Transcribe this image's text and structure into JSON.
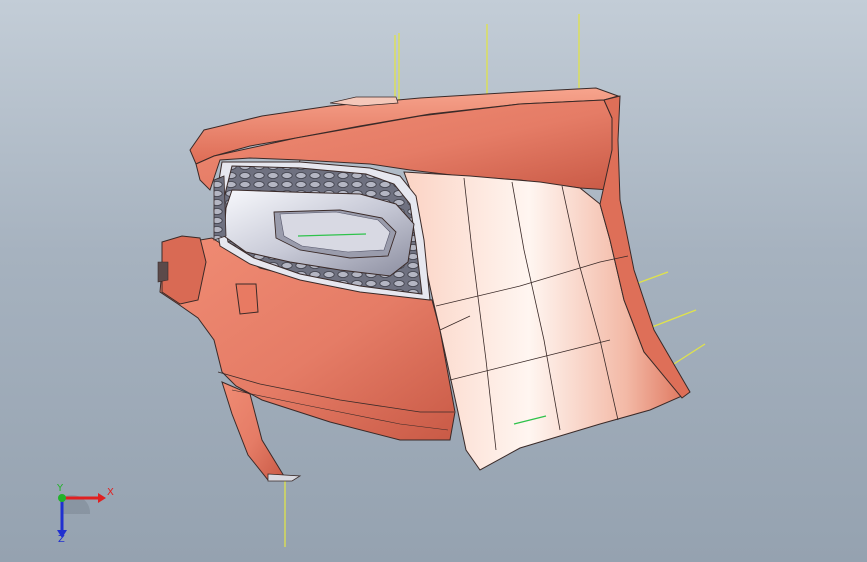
{
  "viewport": {
    "background_top": "#c3cdd7",
    "background_bottom": "#95a2b0"
  },
  "model": {
    "body_color": "#e57c66",
    "body_shade": "#c95a46",
    "highlight_color": "#fff1ea",
    "grille_color": "#8d8f9c",
    "chrome_color": "#e5e6ee",
    "edge_color": "#3a2a28",
    "reference_line_color": "#e0e34a",
    "sketch_line_color": "#2ec24b"
  },
  "triad": {
    "x_label": "X",
    "y_label": "Y",
    "z_label": "Z",
    "x_color": "#e02020",
    "y_color": "#22b22a",
    "z_color": "#2030d0"
  }
}
